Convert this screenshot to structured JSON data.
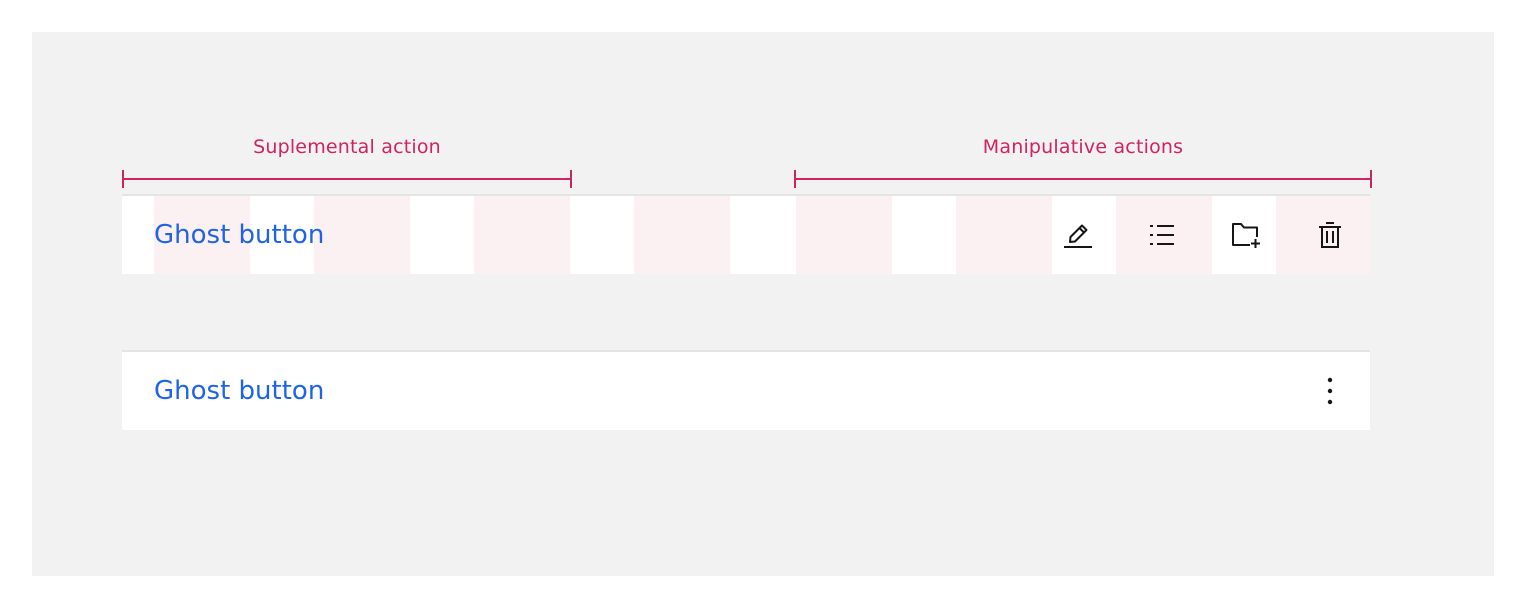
{
  "annotations": {
    "supplemental_label": "Suplemental action",
    "manipulative_label": "Manipulative actions",
    "color": "#d0235f"
  },
  "toolbar_expanded": {
    "ghost_button_label": "Ghost button",
    "icons": [
      "edit-icon",
      "list-icon",
      "folder-add-icon",
      "trash-icon"
    ]
  },
  "toolbar_collapsed": {
    "ghost_button_label": "Ghost button",
    "icons": [
      "overflow-menu-vertical-icon"
    ]
  },
  "colors": {
    "canvas": "#f2f2f2",
    "ghost_text": "#1f63e9",
    "grid_column": "#fbf0f2"
  }
}
